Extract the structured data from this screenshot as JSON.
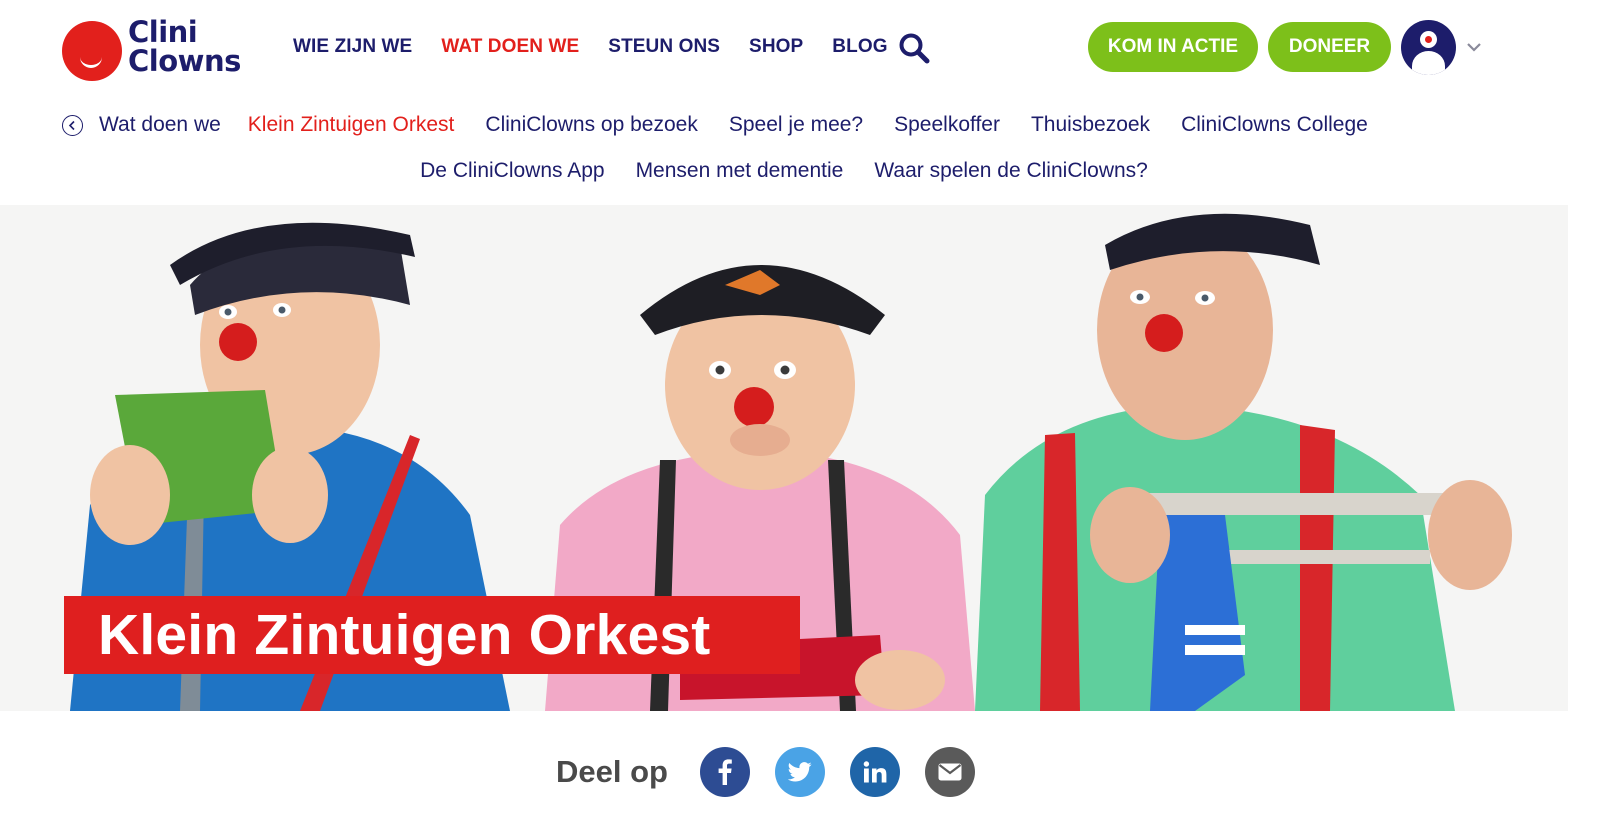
{
  "logo": {
    "line1": "Clini",
    "line2": "Clowns"
  },
  "main_nav": [
    {
      "label": "WIE ZIJN WE",
      "active": false
    },
    {
      "label": "WAT DOEN WE",
      "active": true
    },
    {
      "label": "STEUN ONS",
      "active": false
    },
    {
      "label": "SHOP",
      "active": false
    },
    {
      "label": "BLOG",
      "active": false
    }
  ],
  "buttons": {
    "action": "KOM IN ACTIE",
    "donate": "DONEER"
  },
  "sub_nav": {
    "back_label": "Wat doen we",
    "items": [
      "Klein Zintuigen Orkest",
      "CliniClowns op bezoek",
      "Speel je mee?",
      "Speelkoffer",
      "Thuisbezoek",
      "CliniClowns College",
      "De CliniClowns App",
      "Mensen met dementie",
      "Waar spelen de CliniClowns?"
    ],
    "active_item": "Klein Zintuigen Orkest"
  },
  "hero": {
    "title": "Klein Zintuigen Orkest"
  },
  "share": {
    "label": "Deel op",
    "targets": [
      "facebook-icon",
      "twitter-icon",
      "linkedin-icon",
      "mail-icon"
    ]
  },
  "colors": {
    "brand_navy": "#1d1d6b",
    "brand_red": "#e2201c",
    "cta_green": "#7dc01a",
    "facebook": "#2d4c93",
    "twitter": "#4aa3e6",
    "linkedin": "#1f65a8",
    "mail": "#5a5a5a"
  }
}
